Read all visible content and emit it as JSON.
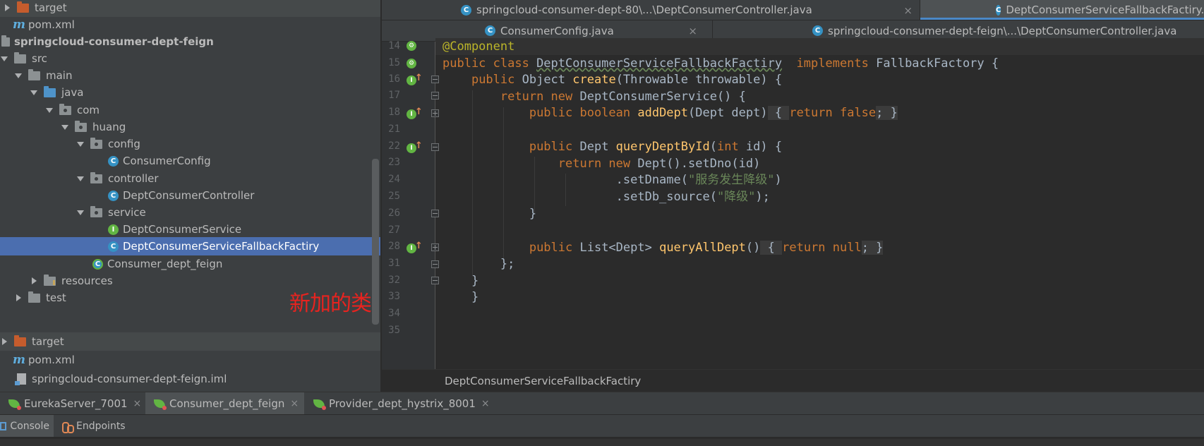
{
  "project_tree": {
    "rows": [
      {
        "label": "target",
        "icon": "folder-orange-icon",
        "arrow": "right",
        "state": "dim"
      },
      {
        "label": "pom.xml",
        "icon": "maven-icon"
      },
      {
        "label": "springcloud-consumer-dept-feign",
        "icon": "module-icon",
        "bold": true
      },
      {
        "label": "src",
        "icon": "folder-grey-icon",
        "arrow": "down"
      },
      {
        "label": "main",
        "icon": "folder-grey-icon",
        "arrow": "down"
      },
      {
        "label": "java",
        "icon": "folder-blue-icon",
        "arrow": "down"
      },
      {
        "label": "com",
        "icon": "package-icon",
        "arrow": "down"
      },
      {
        "label": "huang",
        "icon": "package-icon",
        "arrow": "down"
      },
      {
        "label": "config",
        "icon": "package-icon",
        "arrow": "down"
      },
      {
        "label": "ConsumerConfig",
        "icon": "class-icon"
      },
      {
        "label": "controller",
        "icon": "package-icon",
        "arrow": "down"
      },
      {
        "label": "DeptConsumerController",
        "icon": "class-icon"
      },
      {
        "label": "service",
        "icon": "package-icon",
        "arrow": "down"
      },
      {
        "label": "DeptConsumerService",
        "icon": "interface-icon"
      },
      {
        "label": "DeptConsumerServiceFallbackFactiry",
        "icon": "class-icon",
        "state": "selected"
      },
      {
        "label": "Consumer_dept_feign",
        "icon": "spring-boot-class-icon"
      },
      {
        "label": "resources",
        "icon": "resources-folder-icon",
        "arrow": "right"
      },
      {
        "label": "test",
        "icon": "folder-grey-icon",
        "arrow": "right"
      },
      {
        "label": "target",
        "icon": "folder-orange-icon",
        "arrow": "right",
        "state": "dim"
      },
      {
        "label": "pom.xml",
        "icon": "maven-icon"
      },
      {
        "label": "springcloud-consumer-dept-feign.iml",
        "icon": "iml-file-icon"
      }
    ],
    "annotation": "新加的类"
  },
  "editor_tabs": {
    "row1": [
      {
        "label": "springcloud-consumer-dept-80\\...\\DeptConsumerController.java",
        "close": "×"
      },
      {
        "label": "DeptConsumerServiceFallbackFactiry.java",
        "active": true
      }
    ],
    "row2": [
      {
        "label": "ConsumerConfig.java",
        "close": "×"
      },
      {
        "label": "springcloud-consumer-dept-feign\\...\\DeptConsumerController.java"
      }
    ]
  },
  "editor": {
    "line_numbers": [
      "14",
      "15",
      "16",
      "17",
      "18",
      "21",
      "22",
      "23",
      "24",
      "25",
      "26",
      "27",
      "28",
      "31",
      "32",
      "33",
      "34",
      "35"
    ],
    "code": {
      "l14": "@Component",
      "l15_kw": "public class ",
      "l15_name": "DeptConsumerServiceFallbackFactiry",
      "l15_kw2": "  implements ",
      "l15_rest": "FallbackFactory {",
      "l16_kw": "public ",
      "l16_type": "Object ",
      "l16_fn": "create",
      "l16_rest": "(Throwable throwable) {",
      "l17_kw": "return new ",
      "l17_rest": "DeptConsumerService() {",
      "l18_kw": "public boolean ",
      "l18_fn": "addDept",
      "l18_rest": "(Dept dept)",
      "l18_fold": " { ",
      "l18_kw2": "return false",
      "l18_end": "; }",
      "l22_kw": "public ",
      "l22_type": "Dept ",
      "l22_fn": "queryDeptById",
      "l22_p1": "(",
      "l22_kw2": "int ",
      "l22_p2": "id) {",
      "l23_kw": "return new ",
      "l23_rest": "Dept().setDno(id)",
      "l24_a": ".setDname(",
      "l24_str": "\"服务发生降级\"",
      "l24_b": ")",
      "l25_a": ".setDb_source(",
      "l25_str": "\"降级\"",
      "l25_b": ");",
      "l26": "}",
      "l28_kw": "public ",
      "l28_type": "List<Dept> ",
      "l28_fn": "queryAllDept",
      "l28_rest": "()",
      "l28_fold": " { ",
      "l28_kw2": "return null",
      "l28_end": "; }",
      "l31": "};",
      "l32": "}",
      "l33": "}"
    },
    "breadcrumb": "DeptConsumerServiceFallbackFactiry"
  },
  "run_tabs": [
    {
      "label": "EurekaServer_7001",
      "close": "×"
    },
    {
      "label": "Consumer_dept_feign",
      "close": "×",
      "active": true
    },
    {
      "label": "Provider_dept_hystrix_8001",
      "close": "×"
    }
  ],
  "tool_tabs": [
    {
      "label": "Console",
      "active": true
    },
    {
      "label": "Endpoints"
    }
  ],
  "colors": {
    "keyword": "#cc7832",
    "function": "#ffc66d",
    "string": "#6a8759",
    "annotation": "#bbb529",
    "selection": "#4b6eaf",
    "annotation_red": "#e8231f"
  }
}
